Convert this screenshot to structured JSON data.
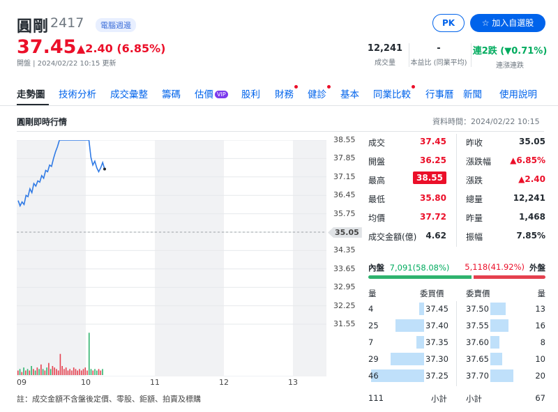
{
  "header": {
    "name": "圓剛",
    "code": "2417",
    "badge": "電腦週邊",
    "pk_label": "PK",
    "add_label": "加入自選股",
    "price": "37.45",
    "change": "▲2.40 (6.85%)",
    "status": "開盤 | 2024/02/22 10:15 更新"
  },
  "stats": [
    {
      "value": "12,241",
      "label": "成交量"
    },
    {
      "value": "-",
      "label": "本益比 (同業平均)"
    },
    {
      "value": "連2跌 (▼0.71%)",
      "label": "連漲連跌"
    }
  ],
  "tabs": [
    {
      "label": "走勢圖",
      "active": true,
      "dot": false
    },
    {
      "label": "技術分析",
      "dot": false
    },
    {
      "label": "成交彙整",
      "dot": false
    },
    {
      "label": "籌碼",
      "dot": false
    },
    {
      "label": "估價",
      "vip": "VIP",
      "dot": false
    },
    {
      "label": "股利",
      "dot": false
    },
    {
      "label": "財務",
      "dot": true
    },
    {
      "label": "健診",
      "dot": true
    },
    {
      "label": "基本",
      "dot": false
    },
    {
      "label": "同業比較",
      "dot": true
    },
    {
      "label": "行事曆",
      "dot": false
    },
    {
      "label": "新聞",
      "dot": false
    },
    {
      "label": "使用說明",
      "dot": false
    }
  ],
  "section": {
    "title": "圓剛即時行情",
    "data_time": "資料時間：2024/02/22 10:15"
  },
  "chart_data": {
    "type": "line",
    "x_ticks": [
      "09",
      "10",
      "11",
      "12",
      "13"
    ],
    "y_ticks": [
      "38.55",
      "37.85",
      "37.15",
      "36.45",
      "35.75",
      "35.05",
      "34.35",
      "33.65",
      "32.95",
      "32.25",
      "31.55"
    ],
    "reference_price": "35.05",
    "ylim": [
      31.55,
      38.55
    ],
    "price_series": [
      36.25,
      36.05,
      36.2,
      36.1,
      36.45,
      36.4,
      36.7,
      36.55,
      36.9,
      36.8,
      37.0,
      36.95,
      37.2,
      37.1,
      37.4,
      37.35,
      37.6,
      37.55,
      37.85,
      38.1,
      38.3,
      38.55,
      38.55,
      38.55,
      38.55,
      38.55,
      38.55,
      38.55,
      38.55,
      38.55,
      38.55,
      38.55,
      38.55,
      38.55,
      38.55,
      38.55,
      38.55,
      37.9,
      37.6,
      37.75,
      37.5,
      37.35,
      37.5,
      37.7,
      37.45
    ],
    "volume_series": [
      3,
      4,
      2,
      5,
      3,
      4,
      3,
      6,
      4,
      3,
      5,
      4,
      7,
      4,
      3,
      5,
      8,
      4,
      6,
      5,
      4,
      3,
      14,
      6,
      4,
      5,
      3,
      4,
      3,
      5,
      4,
      3,
      4,
      3,
      4,
      5,
      3,
      28,
      4,
      3,
      4,
      3,
      4,
      3,
      4
    ]
  },
  "quote_left": [
    {
      "label": "成交",
      "value": "37.45",
      "color": "red"
    },
    {
      "label": "開盤",
      "value": "36.25",
      "color": "red"
    },
    {
      "label": "最高",
      "value": "38.55",
      "color": "highlight"
    },
    {
      "label": "最低",
      "value": "35.80",
      "color": "red"
    },
    {
      "label": "均價",
      "value": "37.72",
      "color": "red"
    },
    {
      "label": "成交金額(億)",
      "value": "4.62",
      "color": "black"
    }
  ],
  "quote_right": [
    {
      "label": "昨收",
      "value": "35.05",
      "color": "black"
    },
    {
      "label": "漲跌幅",
      "value": "▲6.85%",
      "color": "red"
    },
    {
      "label": "漲跌",
      "value": "▲2.40",
      "color": "red"
    },
    {
      "label": "總量",
      "value": "12,241",
      "color": "black"
    },
    {
      "label": "昨量",
      "value": "1,468",
      "color": "black"
    },
    {
      "label": "振幅",
      "value": "7.85%",
      "color": "black"
    }
  ],
  "inout": {
    "inner_label": "內盤",
    "inner_value": "7,091(58.08%)",
    "outer_value": "5,118(41.92%)",
    "outer_label": "外盤",
    "inner_ratio": 0.5808
  },
  "orderbook": {
    "headers": [
      "量",
      "委買價",
      "委賣價",
      "量"
    ],
    "rows": [
      {
        "bid_qty": "4",
        "bid_price": "37.45",
        "ask_price": "37.50",
        "ask_qty": "13",
        "bid_ratio": 0.09,
        "ask_ratio": 0.43
      },
      {
        "bid_qty": "25",
        "bid_price": "37.40",
        "ask_price": "37.55",
        "ask_qty": "16",
        "bid_ratio": 0.54,
        "ask_ratio": 0.52
      },
      {
        "bid_qty": "7",
        "bid_price": "37.35",
        "ask_price": "37.60",
        "ask_qty": "8",
        "bid_ratio": 0.15,
        "ask_ratio": 0.26
      },
      {
        "bid_qty": "29",
        "bid_price": "37.30",
        "ask_price": "37.65",
        "ask_qty": "10",
        "bid_ratio": 0.63,
        "ask_ratio": 0.33
      },
      {
        "bid_qty": "46",
        "bid_price": "37.25",
        "ask_price": "37.70",
        "ask_qty": "20",
        "bid_ratio": 1.0,
        "ask_ratio": 0.65
      }
    ],
    "bid_total_label": "111",
    "subtotal_label": "小計",
    "ask_total_label": "67"
  },
  "footer": {
    "note": "註：成交金額不含盤後定價、零股、鉅額、拍賣及標購"
  }
}
